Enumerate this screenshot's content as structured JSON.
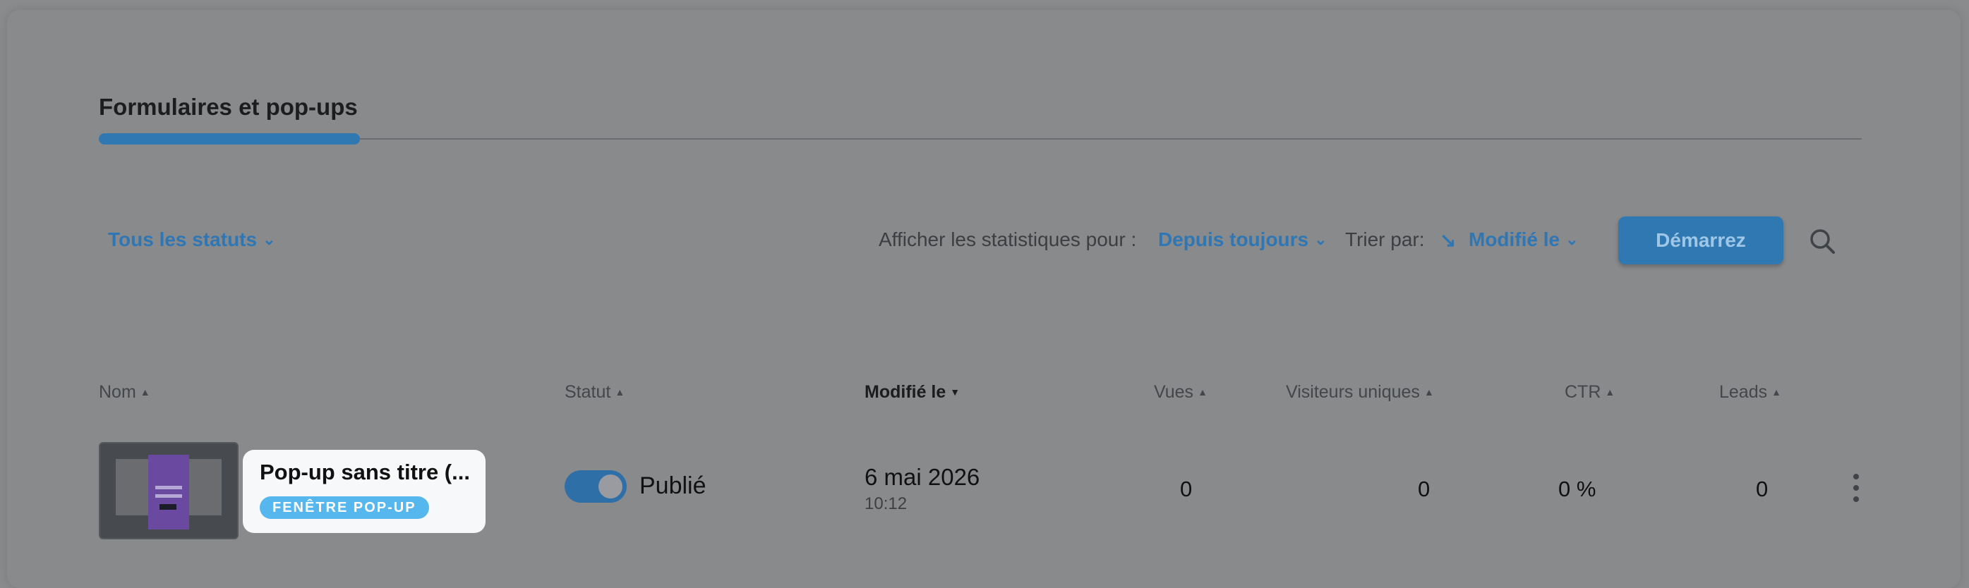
{
  "section": {
    "title": "Formulaires et pop-ups"
  },
  "filters": {
    "status_filter": "Tous les statuts",
    "stats_label": "Afficher les statistiques pour :",
    "period": "Depuis toujours",
    "sort_label": "Trier par:",
    "sort_field": "Modifié le",
    "chevron": "⌄",
    "sort_direction_glyph": "↘"
  },
  "toolbar": {
    "start_button": "Démarrez"
  },
  "table": {
    "columns": [
      {
        "label": "Nom",
        "sort_icon": "▲"
      },
      {
        "label": "Statut",
        "sort_icon": "▲"
      },
      {
        "label": "Modifié le",
        "sort_icon": "▼"
      },
      {
        "label": "Vues",
        "sort_icon": "▲"
      },
      {
        "label": "Visiteurs uniques",
        "sort_icon": "▲"
      },
      {
        "label": "CTR",
        "sort_icon": "▲"
      },
      {
        "label": "Leads",
        "sort_icon": "▲"
      }
    ],
    "rows": [
      {
        "name": "Pop-up sans titre (...",
        "type_badge": "FENÊTRE POP-UP",
        "status": "Publié",
        "status_enabled": true,
        "modified_date": "6 mai 2026",
        "modified_time": "10:12",
        "views": "0",
        "unique_visitors": "0",
        "ctr": "0 %",
        "leads": "0"
      }
    ]
  },
  "icons": {
    "search": "search-icon",
    "kebab": "more-vertical-icon",
    "chevron": "chevron-down-icon",
    "sort_direction": "sort-descending-icon"
  },
  "colors": {
    "accent": "#2f76b4",
    "badge": "#56b6ee",
    "toggle_on": "#2f6fa8",
    "overlay_bg": "#8a8b8d"
  }
}
